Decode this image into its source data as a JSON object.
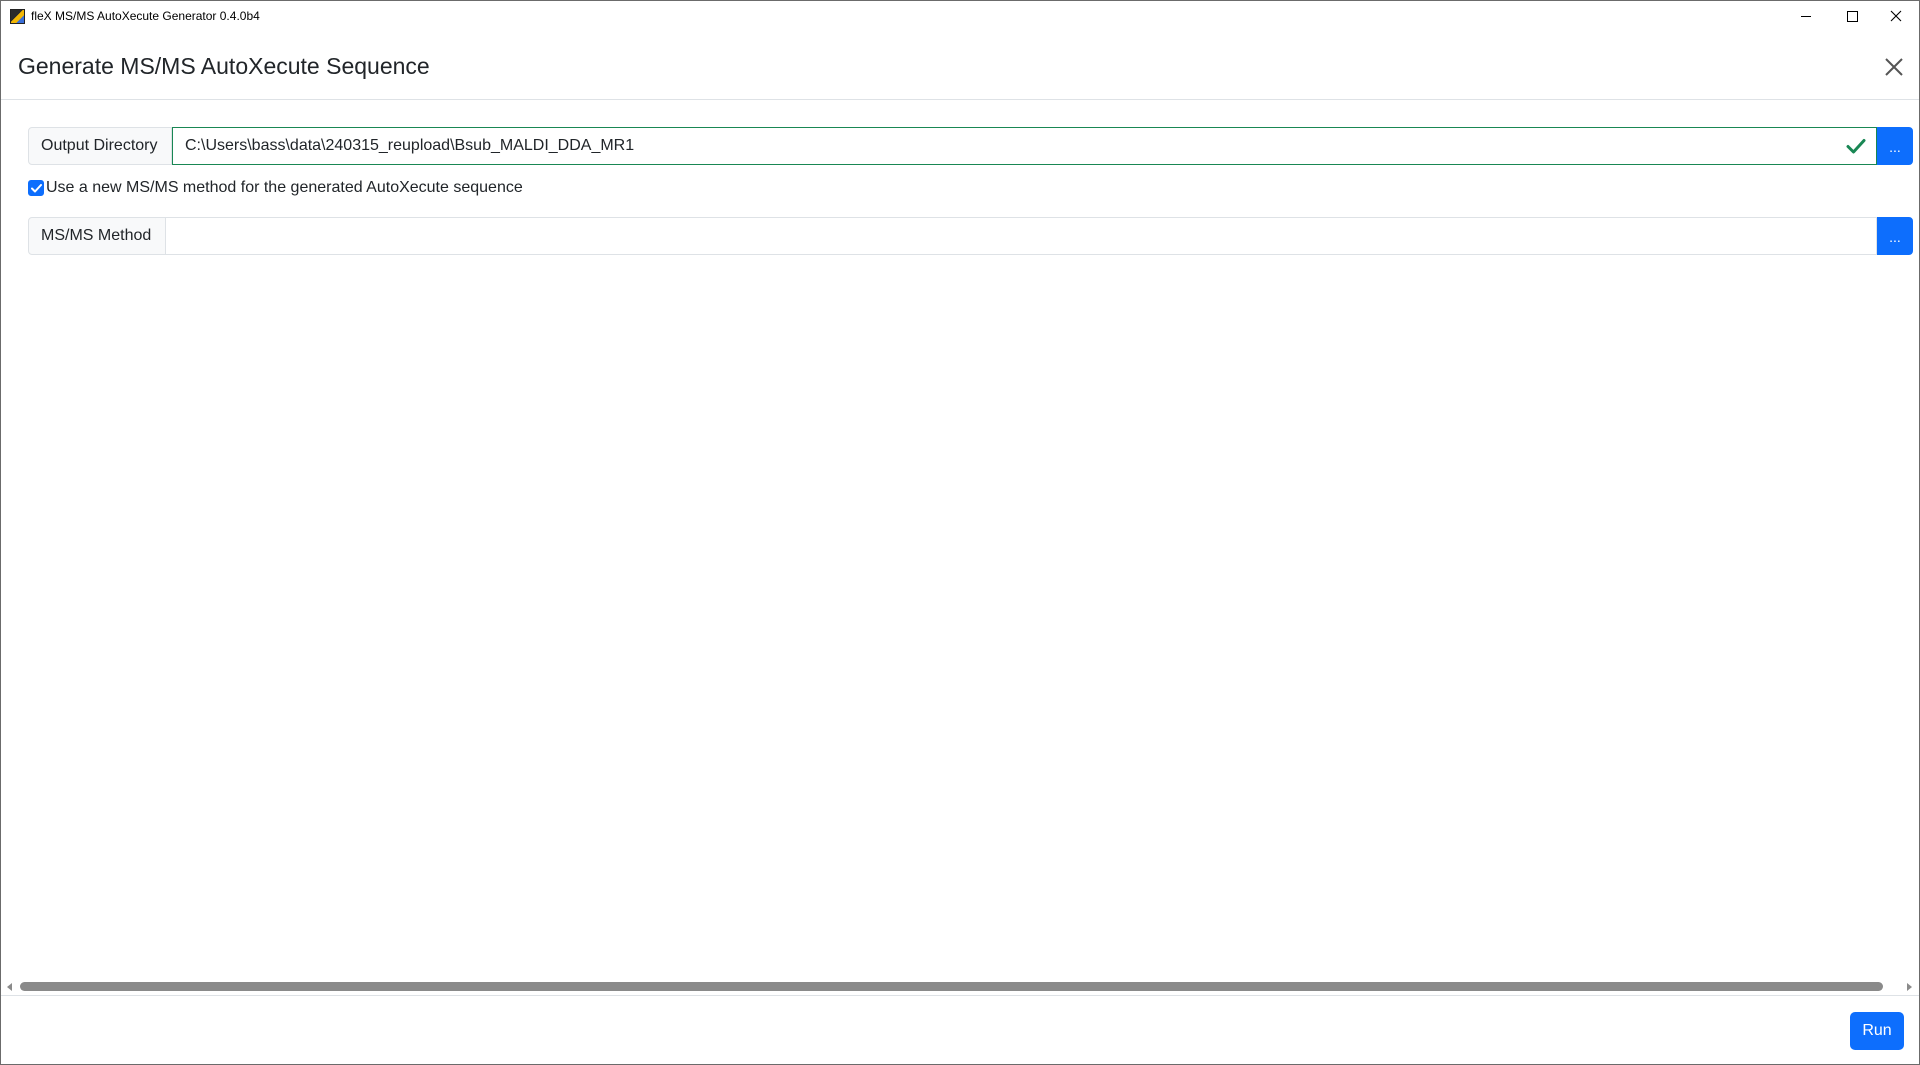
{
  "window": {
    "title": "fleX MS/MS AutoXecute Generator 0.4.0b4",
    "icon": "app-icon",
    "controls": [
      "minimize-icon",
      "maximize-icon",
      "close-icon"
    ]
  },
  "dialog": {
    "title": "Generate MS/MS AutoXecute Sequence",
    "close_icon": "close-icon"
  },
  "form": {
    "output_directory": {
      "label": "Output Directory",
      "value": "C:\\Users\\bass\\data\\240315_reupload\\Bsub_MALDI_DDA_MR1",
      "valid": true,
      "browse_label": "..."
    },
    "use_new_method": {
      "checked": true,
      "label": "Use a new MS/MS method for the generated AutoXecute sequence"
    },
    "msms_method": {
      "label": "MS/MS Method",
      "value": "",
      "browse_label": "..."
    }
  },
  "footer": {
    "run_label": "Run"
  },
  "colors": {
    "primary": "#0d6efd",
    "valid": "#198754",
    "border": "#dee2e6"
  }
}
